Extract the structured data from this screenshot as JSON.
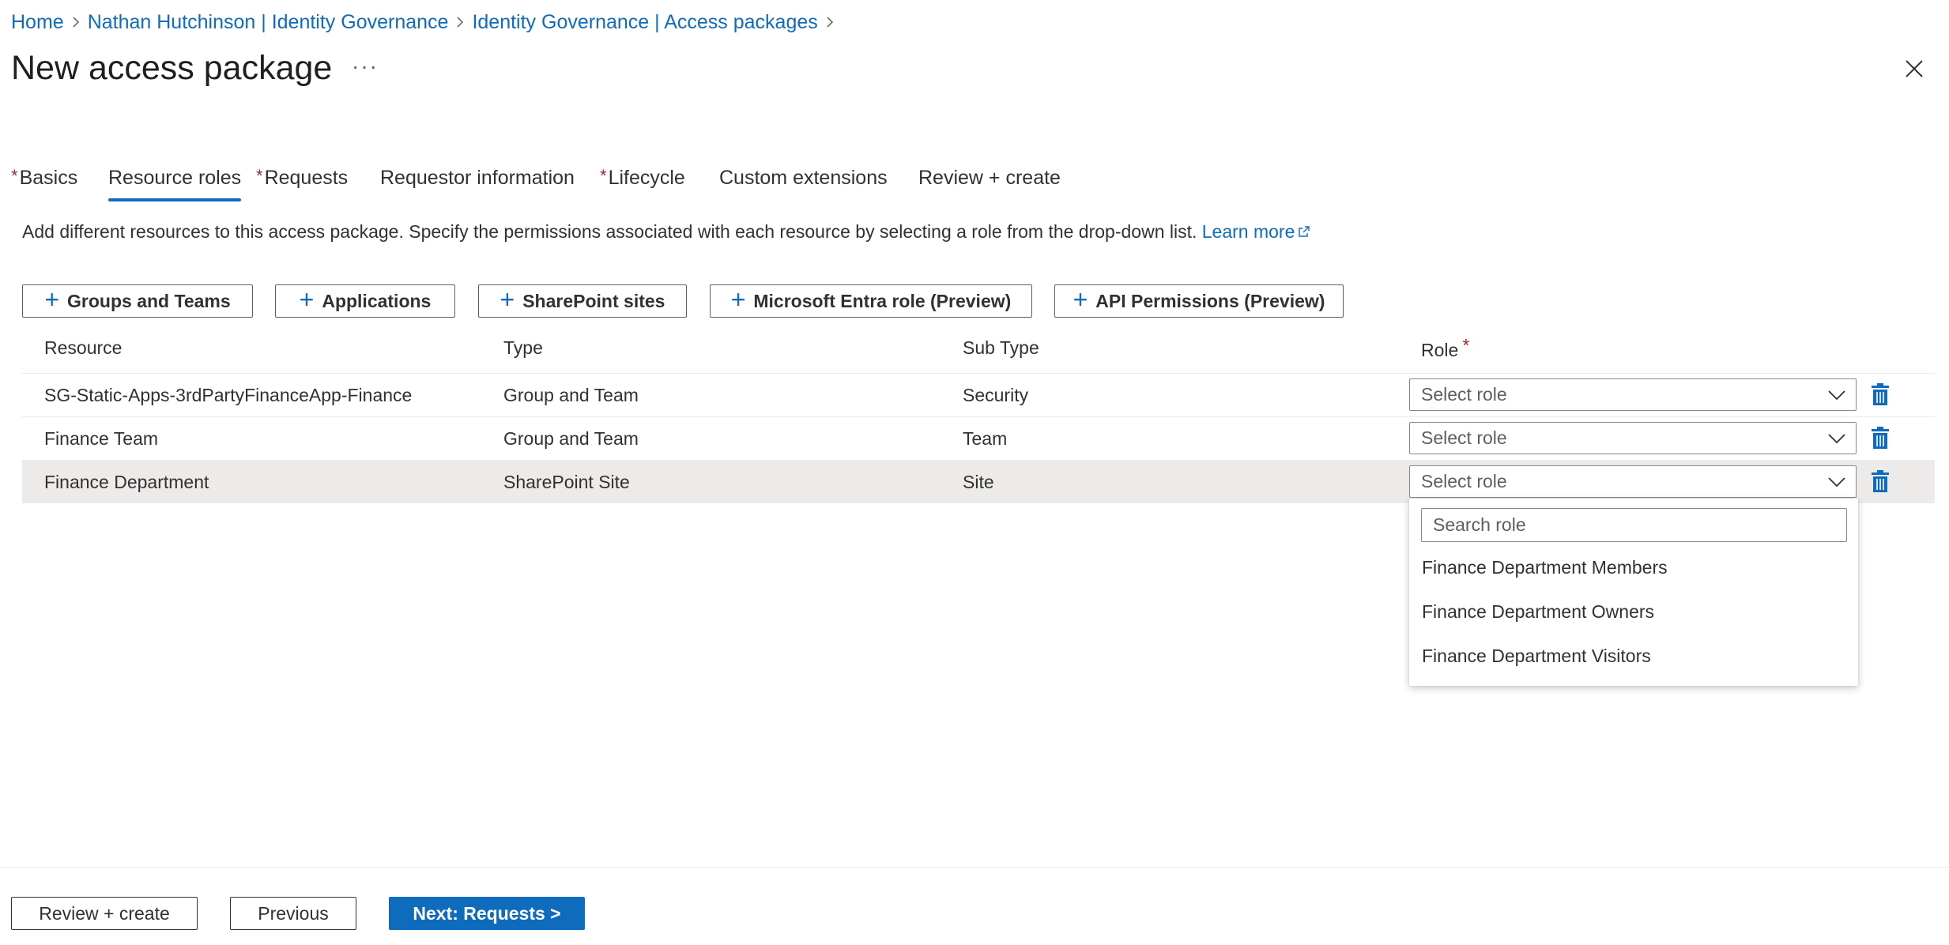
{
  "breadcrumb": [
    "Home",
    "Nathan Hutchinson | Identity Governance",
    "Identity Governance | Access packages"
  ],
  "title": "New access package",
  "more_label": "···",
  "tabs": [
    {
      "label": "Basics",
      "required": true,
      "active": false
    },
    {
      "label": "Resource roles",
      "required": false,
      "active": true
    },
    {
      "label": "Requests",
      "required": true,
      "active": false
    },
    {
      "label": "Requestor information",
      "required": false,
      "active": false
    },
    {
      "label": "Lifecycle",
      "required": true,
      "active": false
    },
    {
      "label": "Custom extensions",
      "required": false,
      "active": false
    },
    {
      "label": "Review + create",
      "required": false,
      "active": false
    }
  ],
  "required_marker": "*",
  "description": {
    "text": "Add different resources to this access package. Specify the permissions associated with each resource by selecting a role from the drop-down list. ",
    "link": "Learn more"
  },
  "commands": {
    "plus": "+",
    "items": [
      "Groups and Teams",
      "Applications",
      "SharePoint sites",
      "Microsoft Entra role (Preview)",
      "API Permissions (Preview)"
    ]
  },
  "table": {
    "headers": {
      "resource": "Resource",
      "type": "Type",
      "subtype": "Sub Type",
      "role": "Role"
    },
    "rows": [
      {
        "resource": "SG-Static-Apps-3rdPartyFinanceApp-Finance",
        "type": "Group and Team",
        "subtype": "Security",
        "role": "Select role",
        "selected": false
      },
      {
        "resource": "Finance Team",
        "type": "Group and Team",
        "subtype": "Team",
        "role": "Select role",
        "selected": false
      },
      {
        "resource": "Finance Department",
        "type": "SharePoint Site",
        "subtype": "Site",
        "role": "Select role",
        "selected": true
      }
    ]
  },
  "role_popup": {
    "search_placeholder": "Search role",
    "options": [
      "Finance Department Members",
      "Finance Department Owners",
      "Finance Department Visitors"
    ]
  },
  "footer": {
    "review": "Review + create",
    "previous": "Previous",
    "next": "Next: Requests >"
  },
  "colors": {
    "accent": "#0f6cbd",
    "required": "#a4262c",
    "selected_row": "#edebe9",
    "text": "#323130"
  },
  "icons": {
    "breadcrumb_separator": "chevron-right-icon",
    "close": "close-icon",
    "dropdown": "chevron-down-icon",
    "delete": "trash-icon",
    "external_link": "external-link-icon"
  }
}
